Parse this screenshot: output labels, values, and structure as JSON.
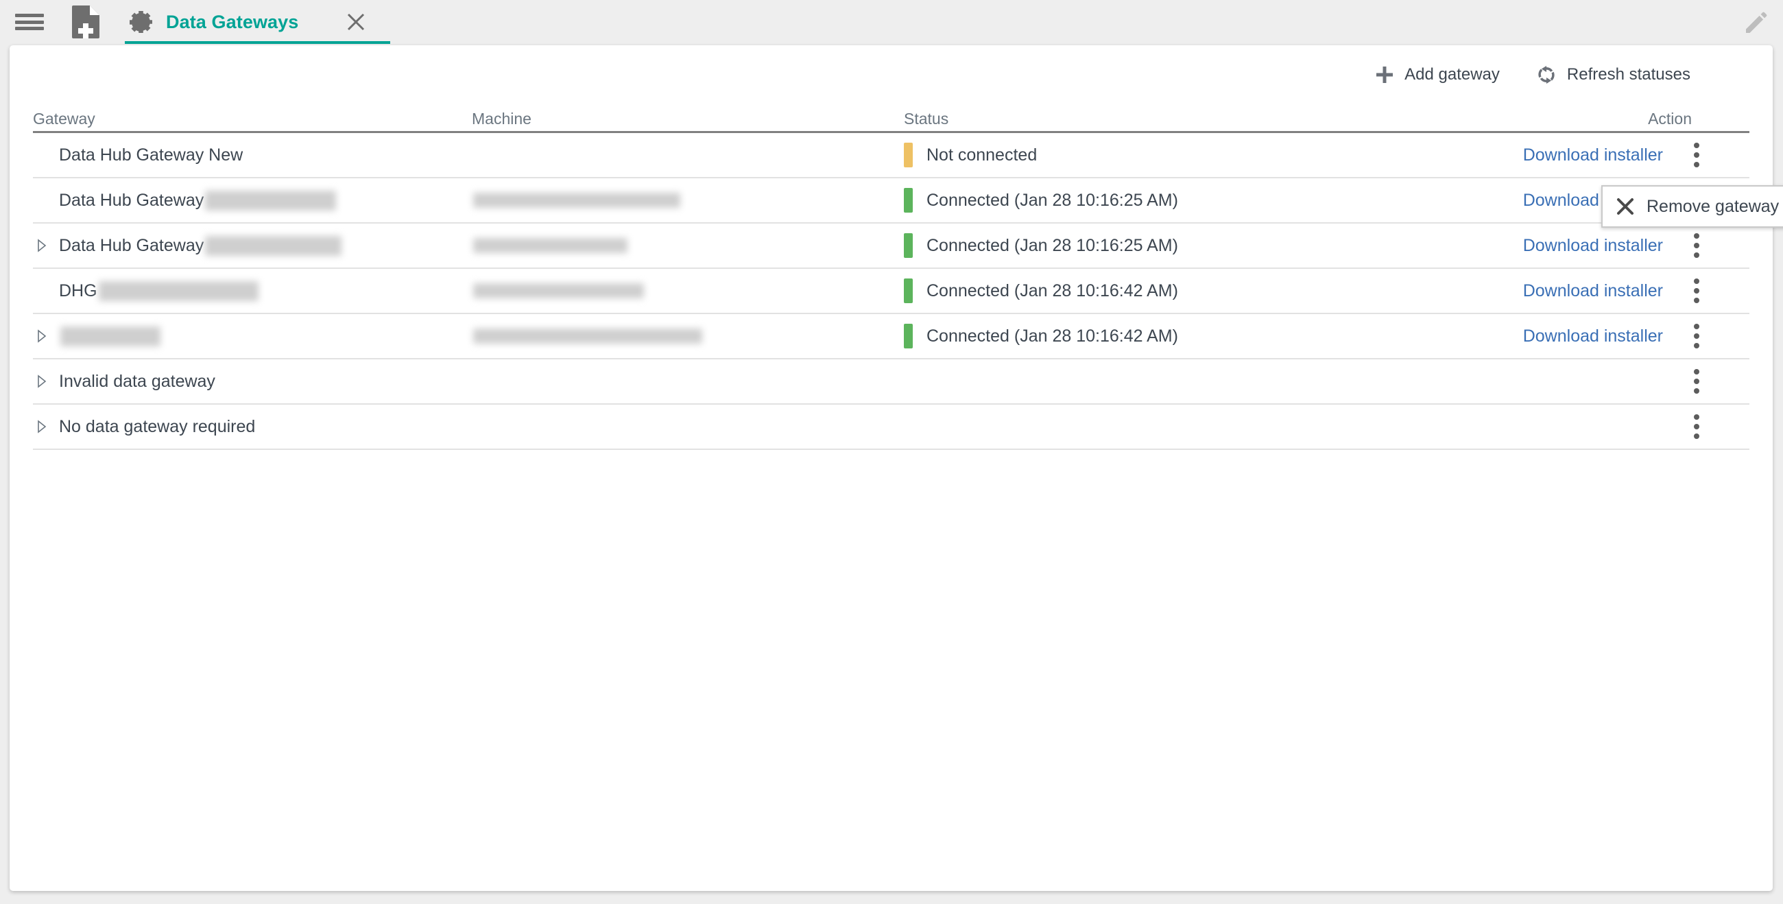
{
  "window": {
    "menu_icon": "hamburger-icon",
    "new_document_icon": "new-document-icon",
    "edit_icon": "pencil-icon"
  },
  "tab": {
    "icon": "gear-icon",
    "title": "Data Gateways",
    "close_icon": "close-icon",
    "accent_color": "#00a395"
  },
  "toolbar": {
    "add_gateway_label": "Add gateway",
    "add_gateway_icon": "plus-icon",
    "refresh_label": "Refresh statuses",
    "refresh_icon": "refresh-icon"
  },
  "table": {
    "columns": [
      "Gateway",
      "Machine",
      "Status",
      "Action"
    ],
    "download_label": "Download installer",
    "kebab_icon": "more-vertical-icon",
    "expand_icon": "chevron-right-icon",
    "status_colors": {
      "connected": "#5cb45c",
      "not_connected": "#eec164"
    },
    "rows": [
      {
        "expandable": false,
        "name": "Data Hub Gateway New",
        "name_redacted": "",
        "machine": "",
        "machine_redacted": "",
        "status": "Not connected",
        "status_state": "not_connected",
        "has_download": true,
        "has_kebab": true
      },
      {
        "expandable": false,
        "name": "Data Hub Gateway",
        "name_redacted": "sPowerPlatform1",
        "machine": "",
        "machine_redacted": "DAP000420.cagetech.local",
        "status": "Connected (Jan 28 10:16:25 AM)",
        "status_state": "connected",
        "has_download": true,
        "has_kebab": true
      },
      {
        "expandable": true,
        "name": "Data Hub Gateway",
        "name_redacted": "_app05_125latest",
        "machine": "",
        "machine_redacted": "APP05.dsv2k12.cep",
        "status": "Connected (Jan 28 10:16:25 AM)",
        "status_state": "connected",
        "has_download": true,
        "has_kebab": true
      },
      {
        "expandable": false,
        "name": "DHG",
        "name_redacted": "_125latest_SQLforall",
        "machine": "",
        "machine_redacted": "SqlFor46.dsv2k12.cep",
        "status": "Connected (Jan 28 10:16:42 AM)",
        "status_state": "connected",
        "has_download": true,
        "has_kebab": true
      },
      {
        "expandable": true,
        "name": "",
        "name_redacted": "gt-elborjan15",
        "machine": "",
        "machine_redacted": "capitol.offsited.captesting.com",
        "status": "Connected (Jan 28 10:16:42 AM)",
        "status_state": "connected",
        "has_download": true,
        "has_kebab": true
      },
      {
        "expandable": true,
        "name": "Invalid data gateway",
        "name_redacted": "",
        "machine": "",
        "machine_redacted": "",
        "status": "",
        "status_state": "none",
        "has_download": false,
        "has_kebab": true
      },
      {
        "expandable": true,
        "name": "No data gateway required",
        "name_redacted": "",
        "machine": "",
        "machine_redacted": "",
        "status": "",
        "status_state": "none",
        "has_download": false,
        "has_kebab": true
      }
    ]
  },
  "context_menu": {
    "icon": "close-x-icon",
    "remove_gateway_label": "Remove gateway"
  }
}
